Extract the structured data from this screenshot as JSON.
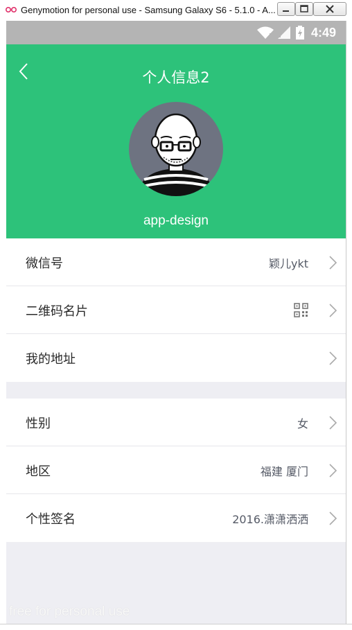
{
  "window": {
    "title": "Genymotion for personal use - Samsung Galaxy S6 - 5.1.0 - A..."
  },
  "statusbar": {
    "time": "4:49"
  },
  "header": {
    "title": "个人信息2",
    "username": "app-design"
  },
  "group1": [
    {
      "label": "微信号",
      "value": "颖儿ykt"
    },
    {
      "label": "二维码名片",
      "value_icon": "qr-code-icon"
    },
    {
      "label": "我的地址",
      "value": ""
    }
  ],
  "group2": [
    {
      "label": "性别",
      "value": "女"
    },
    {
      "label": "地区",
      "value": "福建 厦门"
    },
    {
      "label": "个性签名",
      "value": "2016.潇潇洒洒"
    }
  ],
  "watermark": "free for personal use",
  "colors": {
    "header": "#2dc27a",
    "statusbar": "#b4b4b4",
    "background": "#eeeef3"
  }
}
